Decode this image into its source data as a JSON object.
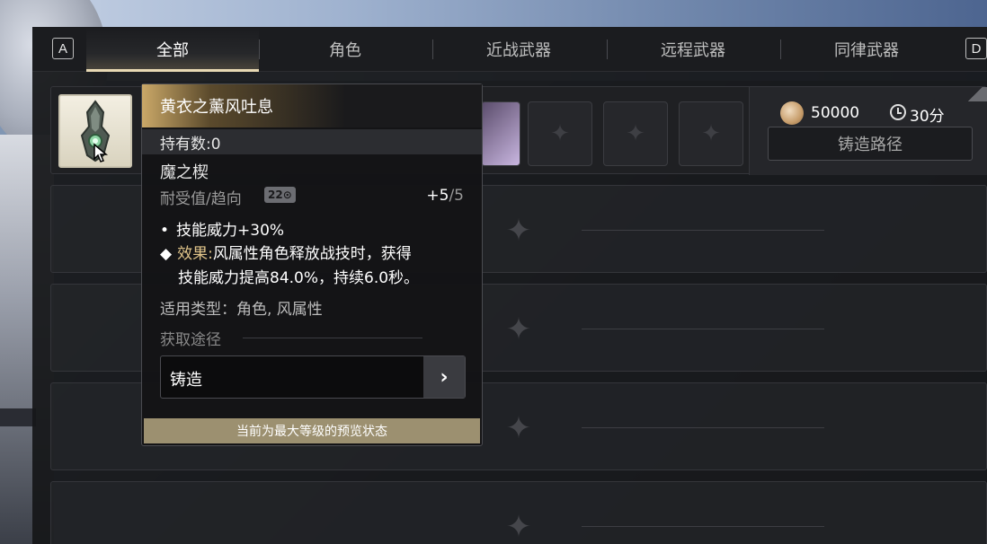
{
  "tabs": {
    "key_left": "A",
    "key_right": "D",
    "items": [
      {
        "label": "全部",
        "active": true
      },
      {
        "label": "角色",
        "active": false
      },
      {
        "label": "近战武器",
        "active": false
      },
      {
        "label": "远程武器",
        "active": false
      },
      {
        "label": "同律武器",
        "active": false
      }
    ]
  },
  "recipe": {
    "item_icon": "module-icon",
    "cost_value": "50000",
    "time_value": "30分",
    "path_button_label": "铸造路径"
  },
  "tooltip": {
    "title": "黄衣之薰风吐息",
    "owned": "持有数:0",
    "name": "魔之楔",
    "durability_label": "耐受值/趋向",
    "durability_badge": "22⊙",
    "durability_value": "+5",
    "durability_max": "/5",
    "bullet_text": "技能威力+30%",
    "effect_label": "效果:",
    "effect_text": "风属性角色释放战技时，获得",
    "effect_text_cont": "技能威力提高84.0%，持续6.0秒。",
    "types": "适用类型：角色, 风属性",
    "source_label": "获取途径",
    "source_item": "铸造",
    "footer": "当前为最大等级的预览状态"
  }
}
